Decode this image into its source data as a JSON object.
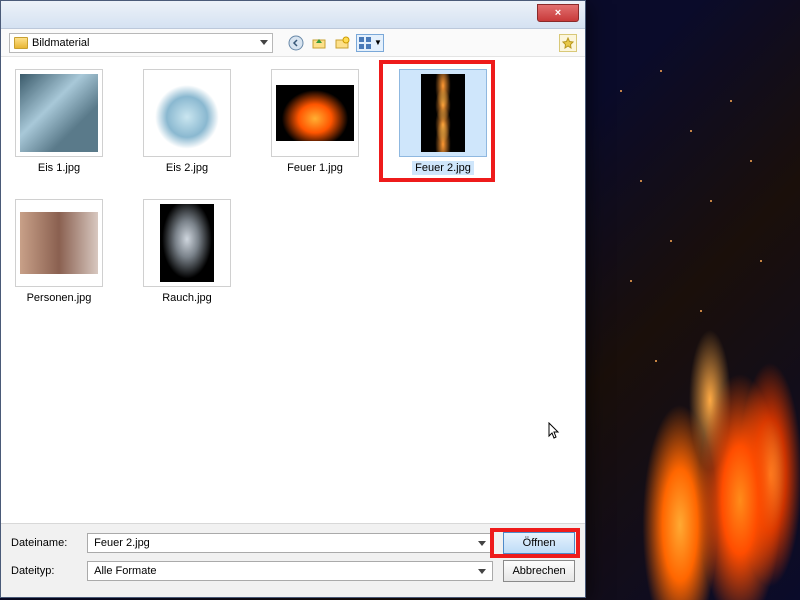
{
  "folder": {
    "name": "Bildmaterial"
  },
  "close": {
    "glyph": "×"
  },
  "files": [
    {
      "name": "Eis 1.jpg"
    },
    {
      "name": "Eis 2.jpg"
    },
    {
      "name": "Feuer 1.jpg"
    },
    {
      "name": "Feuer 2.jpg",
      "selected": true
    },
    {
      "name": "Personen.jpg"
    },
    {
      "name": "Rauch.jpg"
    }
  ],
  "bottom": {
    "filename_label": "Dateiname:",
    "filetype_label": "Dateityp:",
    "filename_value": "Feuer 2.jpg",
    "filetype_value": "Alle Formate",
    "open_label": "Öffnen",
    "cancel_label": "Abbrechen"
  }
}
